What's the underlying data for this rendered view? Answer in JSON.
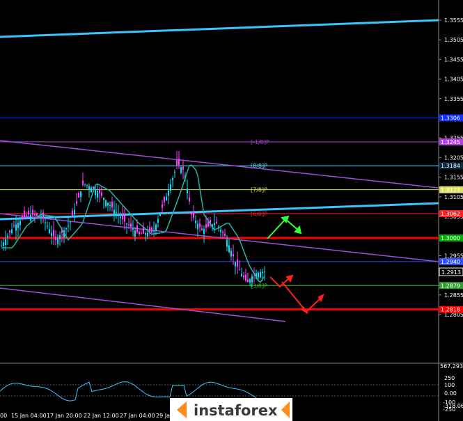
{
  "main_price_axis": {
    "ticks": [
      {
        "value": 1.3555,
        "label": "1.3555"
      },
      {
        "value": 1.3505,
        "label": "1.3505"
      },
      {
        "value": 1.3455,
        "label": "1.3455"
      },
      {
        "value": 1.3405,
        "label": "1.3405"
      },
      {
        "value": 1.3355,
        "label": "1.3355"
      },
      {
        "value": 1.3255,
        "label": "1.3255"
      },
      {
        "value": 1.3205,
        "label": "1.3205"
      },
      {
        "value": 1.3155,
        "label": "1.3155"
      },
      {
        "value": 1.3105,
        "label": "1.3105"
      },
      {
        "value": 1.3055,
        "label": "1.3055"
      },
      {
        "value": 1.2955,
        "label": "1.2955"
      },
      {
        "value": 1.2855,
        "label": "1.2855"
      },
      {
        "value": 1.2805,
        "label": "1.2805"
      }
    ]
  },
  "murrey_levels": [
    {
      "label": "[-1/8]P",
      "value": 1.3245,
      "color": "#b040e0",
      "tag_bg": "#b040e0",
      "tag_text": "1.3245"
    },
    {
      "label": "[8/8]P",
      "value": 1.3184,
      "color": "#60e0ff",
      "tag_bg": "#0c2a40",
      "tag_text": "1.3184"
    },
    {
      "label": "[7/8]P",
      "value": 1.3123,
      "color": "#e0e060",
      "tag_bg": "#e0e060",
      "tag_text": "1.3123"
    },
    {
      "label": "[6/8]P",
      "value": 1.3062,
      "color": "#ff2020",
      "tag_bg": "#ff2020",
      "tag_text": "1.3062"
    },
    {
      "label": "",
      "value": 1.3,
      "color": "#ff0000",
      "tag_bg": "#00b000",
      "tag_text": "1.3000"
    },
    {
      "label": "",
      "value": 1.294,
      "color": "#3050ff",
      "tag_bg": "#3050ff",
      "tag_text": "1.2940"
    },
    {
      "label": "[3/8]P",
      "value": 1.2879,
      "color": "#30c030",
      "tag_bg": "#30a030",
      "tag_text": "1.2879"
    },
    {
      "label": "",
      "value": 1.2818,
      "color": "#ff0000",
      "tag_bg": "#ff0000",
      "tag_text": "1.2818"
    }
  ],
  "upper_level": {
    "value": 1.3306,
    "color": "#1030ff",
    "tag_text": "1.3306"
  },
  "current_price": {
    "value": 1.2913,
    "label": "1.2913"
  },
  "x_axis": {
    "labels": [
      "00",
      "15 Jan 04:00",
      "17 Jan 20:00",
      "22 Jan 12:00",
      "27 Jan 04:00",
      "29 Jan"
    ]
  },
  "indicator": {
    "top_value": "567.2935",
    "ticks": [
      "250",
      "100",
      "0.00",
      "-100",
      "-250"
    ],
    "bottom_value": "-318.064"
  },
  "watermark": {
    "text": "instaforex"
  },
  "colors": {
    "background": "#000000",
    "bull": "#00e0ff",
    "bear": "#ff40ff",
    "channel_blue": "#39c6ff",
    "channel_purple": "#9b50d8",
    "ma": "#23b6a6"
  }
}
